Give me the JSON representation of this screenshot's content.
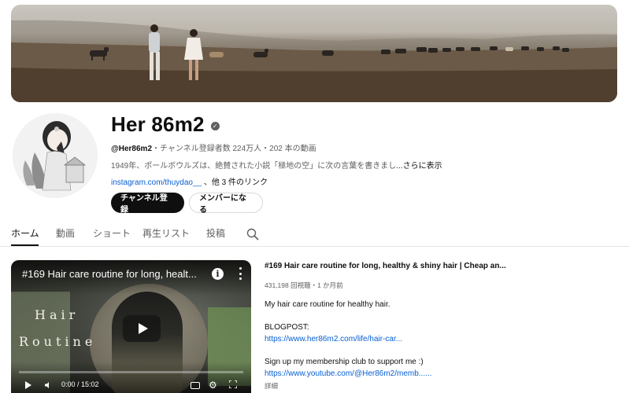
{
  "channel": {
    "name": "Her 86m2",
    "handle": "@Her86m2",
    "stats": "・チャンネル登録者数 224万人・202 本の動画",
    "description": "1949年、ポールボウルズは、絶賛された小説「極地の空」に次の言葉を書きまし",
    "description_more": "...さらに表示",
    "link": "instagram.com/thuydao__",
    "other_links": "、他 3 件のリンク",
    "subscribe_label": "チャンネル登録",
    "member_label": "メンバーになる"
  },
  "tabs": [
    {
      "label": "ホーム",
      "active": true
    },
    {
      "label": "動画",
      "active": false
    },
    {
      "label": "ショート",
      "active": false
    },
    {
      "label": "再生リスト",
      "active": false
    },
    {
      "label": "投稿",
      "active": false
    }
  ],
  "featured": {
    "overlay_title": "#169 Hair care routine for long, healt...",
    "overlay_text_1": "Hair",
    "overlay_text_2": "Routine",
    "time": "0:00 / 15:02",
    "title": "#169 Hair care routine for long, healthy & shiny hair | Cheap an...",
    "stats": "431,198 回視聴・1 か月前",
    "desc_line1": "My hair care routine for healthy hair.",
    "desc_blog_label": "BLOGPOST:",
    "desc_blog_link": "https://www.her86m2.com/life/hair-car...",
    "desc_support": "Sign up my membership club to support me :)",
    "desc_support_link": "https://www.youtube.com/@Her86m2/memb......",
    "more_label": "詳細"
  },
  "icons": {
    "verified": "check-circle",
    "search": "magnifier",
    "info": "info-circle",
    "menu": "kebab-vertical"
  },
  "colors": {
    "accent_link": "#065fd4",
    "subscribe_bg": "#0f0f0f"
  }
}
